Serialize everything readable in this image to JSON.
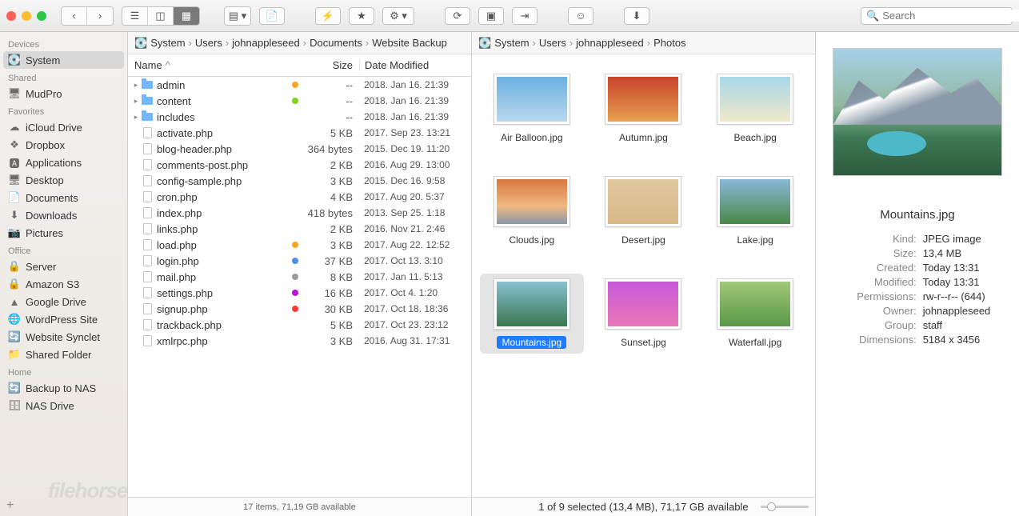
{
  "search_placeholder": "Search",
  "sidebar": {
    "sections": [
      {
        "title": "Devices",
        "items": [
          {
            "icon": "hdd",
            "label": "System",
            "selected": true
          }
        ]
      },
      {
        "title": "Shared",
        "items": [
          {
            "icon": "display",
            "label": "MudPro"
          }
        ]
      },
      {
        "title": "Favorites",
        "items": [
          {
            "icon": "cloud",
            "label": "iCloud Drive"
          },
          {
            "icon": "dropbox",
            "label": "Dropbox"
          },
          {
            "icon": "apps",
            "label": "Applications"
          },
          {
            "icon": "desktop",
            "label": "Desktop"
          },
          {
            "icon": "docs",
            "label": "Documents"
          },
          {
            "icon": "download",
            "label": "Downloads"
          },
          {
            "icon": "camera",
            "label": "Pictures"
          }
        ]
      },
      {
        "title": "Office",
        "items": [
          {
            "icon": "lock",
            "label": "Server"
          },
          {
            "icon": "lock",
            "label": "Amazon S3"
          },
          {
            "icon": "gdrive",
            "label": "Google Drive"
          },
          {
            "icon": "globe",
            "label": "WordPress Site"
          },
          {
            "icon": "sync",
            "label": "Website Synclet"
          },
          {
            "icon": "folder",
            "label": "Shared Folder"
          }
        ]
      },
      {
        "title": "Home",
        "items": [
          {
            "icon": "sync",
            "label": "Backup to NAS"
          },
          {
            "icon": "nas",
            "label": "NAS Drive"
          }
        ]
      }
    ]
  },
  "left_pane": {
    "path": [
      "System",
      "Users",
      "johnappleseed",
      "Documents",
      "Website Backup"
    ],
    "columns": {
      "name": "Name",
      "size": "Size",
      "date": "Date Modified"
    },
    "rows": [
      {
        "type": "folder",
        "name": "admin",
        "tag": "#f5a623",
        "size": "--",
        "date": "2018. Jan 16. 21:39",
        "disc": true
      },
      {
        "type": "folder",
        "name": "content",
        "tag": "#7ed321",
        "size": "--",
        "date": "2018. Jan 16. 21:39",
        "disc": true
      },
      {
        "type": "folder",
        "name": "includes",
        "tag": null,
        "size": "--",
        "date": "2018. Jan 16. 21:39",
        "disc": true
      },
      {
        "type": "file",
        "name": "activate.php",
        "tag": null,
        "size": "5 KB",
        "date": "2017. Sep 23. 13:21"
      },
      {
        "type": "file",
        "name": "blog-header.php",
        "tag": null,
        "size": "364 bytes",
        "date": "2015. Dec 19. 11:20"
      },
      {
        "type": "file",
        "name": "comments-post.php",
        "tag": null,
        "size": "2 KB",
        "date": "2016. Aug 29. 13:00"
      },
      {
        "type": "file",
        "name": "config-sample.php",
        "tag": null,
        "size": "3 KB",
        "date": "2015. Dec 16. 9:58"
      },
      {
        "type": "file",
        "name": "cron.php",
        "tag": null,
        "size": "4 KB",
        "date": "2017. Aug 20. 5:37"
      },
      {
        "type": "file",
        "name": "index.php",
        "tag": null,
        "size": "418 bytes",
        "date": "2013. Sep 25. 1:18"
      },
      {
        "type": "file",
        "name": "links.php",
        "tag": null,
        "size": "2 KB",
        "date": "2016. Nov 21. 2:46"
      },
      {
        "type": "file",
        "name": "load.php",
        "tag": "#f5a623",
        "size": "3 KB",
        "date": "2017. Aug 22. 12:52"
      },
      {
        "type": "file",
        "name": "login.php",
        "tag": "#4a90e2",
        "size": "37 KB",
        "date": "2017. Oct 13. 3:10"
      },
      {
        "type": "file",
        "name": "mail.php",
        "tag": "#9b9b9b",
        "size": "8 KB",
        "date": "2017. Jan 11. 5:13"
      },
      {
        "type": "file",
        "name": "settings.php",
        "tag": "#bd10e0",
        "size": "16 KB",
        "date": "2017. Oct 4. 1:20"
      },
      {
        "type": "file",
        "name": "signup.php",
        "tag": "#ff3b30",
        "size": "30 KB",
        "date": "2017. Oct 18. 18:36"
      },
      {
        "type": "file",
        "name": "trackback.php",
        "tag": null,
        "size": "5 KB",
        "date": "2017. Oct 23. 23:12"
      },
      {
        "type": "file",
        "name": "xmlrpc.php",
        "tag": null,
        "size": "3 KB",
        "date": "2016. Aug 31. 17:31"
      }
    ],
    "status": "17 items, 71,19 GB available"
  },
  "mid_pane": {
    "path": [
      "System",
      "Users",
      "johnappleseed",
      "Photos"
    ],
    "items": [
      {
        "name": "Air Balloon.jpg",
        "bg": "linear-gradient(#6bb0e0,#b8d8ee)"
      },
      {
        "name": "Autumn.jpg",
        "bg": "linear-gradient(#c8432a,#e8a050)"
      },
      {
        "name": "Beach.jpg",
        "bg": "linear-gradient(#a8d8e8,#f0e8c8)"
      },
      {
        "name": "Clouds.jpg",
        "bg": "linear-gradient(#d87840,#f0b880 60%,#8898a8)"
      },
      {
        "name": "Desert.jpg",
        "bg": "linear-gradient(#e0c8a0,#d8b888)"
      },
      {
        "name": "Lake.jpg",
        "bg": "linear-gradient(#88b8d8,#4a8848)"
      },
      {
        "name": "Mountains.jpg",
        "bg": "linear-gradient(#88c0d0,#3a7850)",
        "selected": true
      },
      {
        "name": "Sunset.jpg",
        "bg": "linear-gradient(#c858d8,#e878b8)"
      },
      {
        "name": "Waterfall.jpg",
        "bg": "linear-gradient(#a0c878,#5a9848)"
      }
    ],
    "status": "1 of 9 selected (13,4 MB), 71,17 GB available"
  },
  "preview": {
    "title": "Mountains.jpg",
    "meta": [
      {
        "k": "Kind:",
        "v": "JPEG image"
      },
      {
        "k": "Size:",
        "v": "13,4 MB"
      },
      {
        "k": "Created:",
        "v": "Today 13:31"
      },
      {
        "k": "Modified:",
        "v": "Today 13:31"
      },
      {
        "k": "Permissions:",
        "v": "rw-r--r-- (644)"
      },
      {
        "k": "Owner:",
        "v": "johnappleseed"
      },
      {
        "k": "Group:",
        "v": "staff"
      },
      {
        "k": "Dimensions:",
        "v": "5184 x 3456"
      }
    ]
  }
}
